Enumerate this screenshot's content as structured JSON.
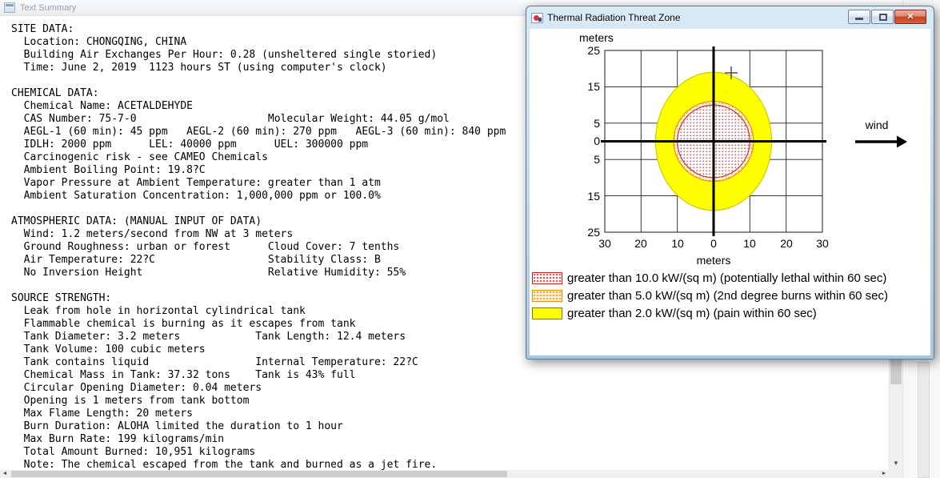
{
  "text_summary_window": {
    "title": "Text Summary",
    "lines": [
      "SITE DATA:",
      "  Location: CHONGQING, CHINA",
      "  Building Air Exchanges Per Hour: 0.28 (unsheltered single storied)",
      "  Time: June 2, 2019  1123 hours ST (using computer's clock)",
      "",
      "CHEMICAL DATA:",
      "  Chemical Name: ACETALDEHYDE",
      "  CAS Number: 75-7-0                     Molecular Weight: 44.05 g/mol",
      "  AEGL-1 (60 min): 45 ppm   AEGL-2 (60 min): 270 ppm   AEGL-3 (60 min): 840 ppm",
      "  IDLH: 2000 ppm      LEL: 40000 ppm      UEL: 300000 ppm",
      "  Carcinogenic risk - see CAMEO Chemicals",
      "  Ambient Boiling Point: 19.8?C",
      "  Vapor Pressure at Ambient Temperature: greater than 1 atm",
      "  Ambient Saturation Concentration: 1,000,000 ppm or 100.0%",
      "",
      "ATMOSPHERIC DATA: (MANUAL INPUT OF DATA)",
      "  Wind: 1.2 meters/second from NW at 3 meters",
      "  Ground Roughness: urban or forest      Cloud Cover: 7 tenths",
      "  Air Temperature: 22?C                  Stability Class: B",
      "  No Inversion Height                    Relative Humidity: 55%",
      "",
      "SOURCE STRENGTH:",
      "  Leak from hole in horizontal cylindrical tank",
      "  Flammable chemical is burning as it escapes from tank",
      "  Tank Diameter: 3.2 meters            Tank Length: 12.4 meters",
      "  Tank Volume: 100 cubic meters",
      "  Tank contains liquid                 Internal Temperature: 22?C",
      "  Chemical Mass in Tank: 37.32 tons    Tank is 43% full",
      "  Circular Opening Diameter: 0.04 meters",
      "  Opening is 1 meters from tank bottom",
      "  Max Flame Length: 20 meters",
      "  Burn Duration: ALOHA limited the duration to 1 hour",
      "  Max Burn Rate: 199 kilograms/min",
      "  Total Amount Burned: 10,951 kilograms",
      "  Note: The chemical escaped from the tank and burned as a jet fire."
    ],
    "scrollbar_icons": {
      "up": "▲",
      "down": "▼",
      "left": "◄",
      "right": "►"
    }
  },
  "threat_window": {
    "title": "Thermal Radiation Threat Zone",
    "controls": {
      "close_glyph": "✕"
    },
    "plot": {
      "top_axis_label": "meters",
      "bottom_axis_label": "meters",
      "wind_label": "wind",
      "y_tick_labels": [
        "25",
        "15",
        "5",
        "0",
        "5",
        "15",
        "25"
      ],
      "x_tick_labels": [
        "30",
        "20",
        "10",
        "0",
        "10",
        "20",
        "30"
      ],
      "x_range_meters": [
        -30,
        30
      ],
      "y_range_meters": [
        -25,
        25
      ],
      "zones": [
        {
          "name": "pain-threat-zone",
          "rx_m": 16,
          "ry_m": 19,
          "cx_m": 0,
          "cy_m": 0,
          "fill": "solid-yellow",
          "stroke": "#cccc00"
        },
        {
          "name": "second-degree-burn-threat-zone",
          "r_m": 11,
          "cx_m": 0,
          "cy_m": 0,
          "fill": "orange-dots",
          "stroke": "#ee8800"
        },
        {
          "name": "lethal-threat-zone",
          "r_m": 10,
          "cx_m": 0,
          "cy_m": 0,
          "fill": "red-dots",
          "stroke": "#cc3333"
        }
      ]
    },
    "legend": [
      {
        "swatch": "red-dots",
        "label": "greater than 10.0 kW/(sq m) (potentially lethal within 60 sec)"
      },
      {
        "swatch": "orange-dots",
        "label": "greater than 5.0 kW/(sq m) (2nd degree burns within 60 sec)"
      },
      {
        "swatch": "solid-yellow",
        "label": "greater than 2.0 kW/(sq m) (pain within 60 sec)"
      }
    ],
    "colors": {
      "lethal_zone": "#e05555",
      "second_degree_zone": "#ffaa33",
      "pain_zone": "#ffff00"
    }
  }
}
